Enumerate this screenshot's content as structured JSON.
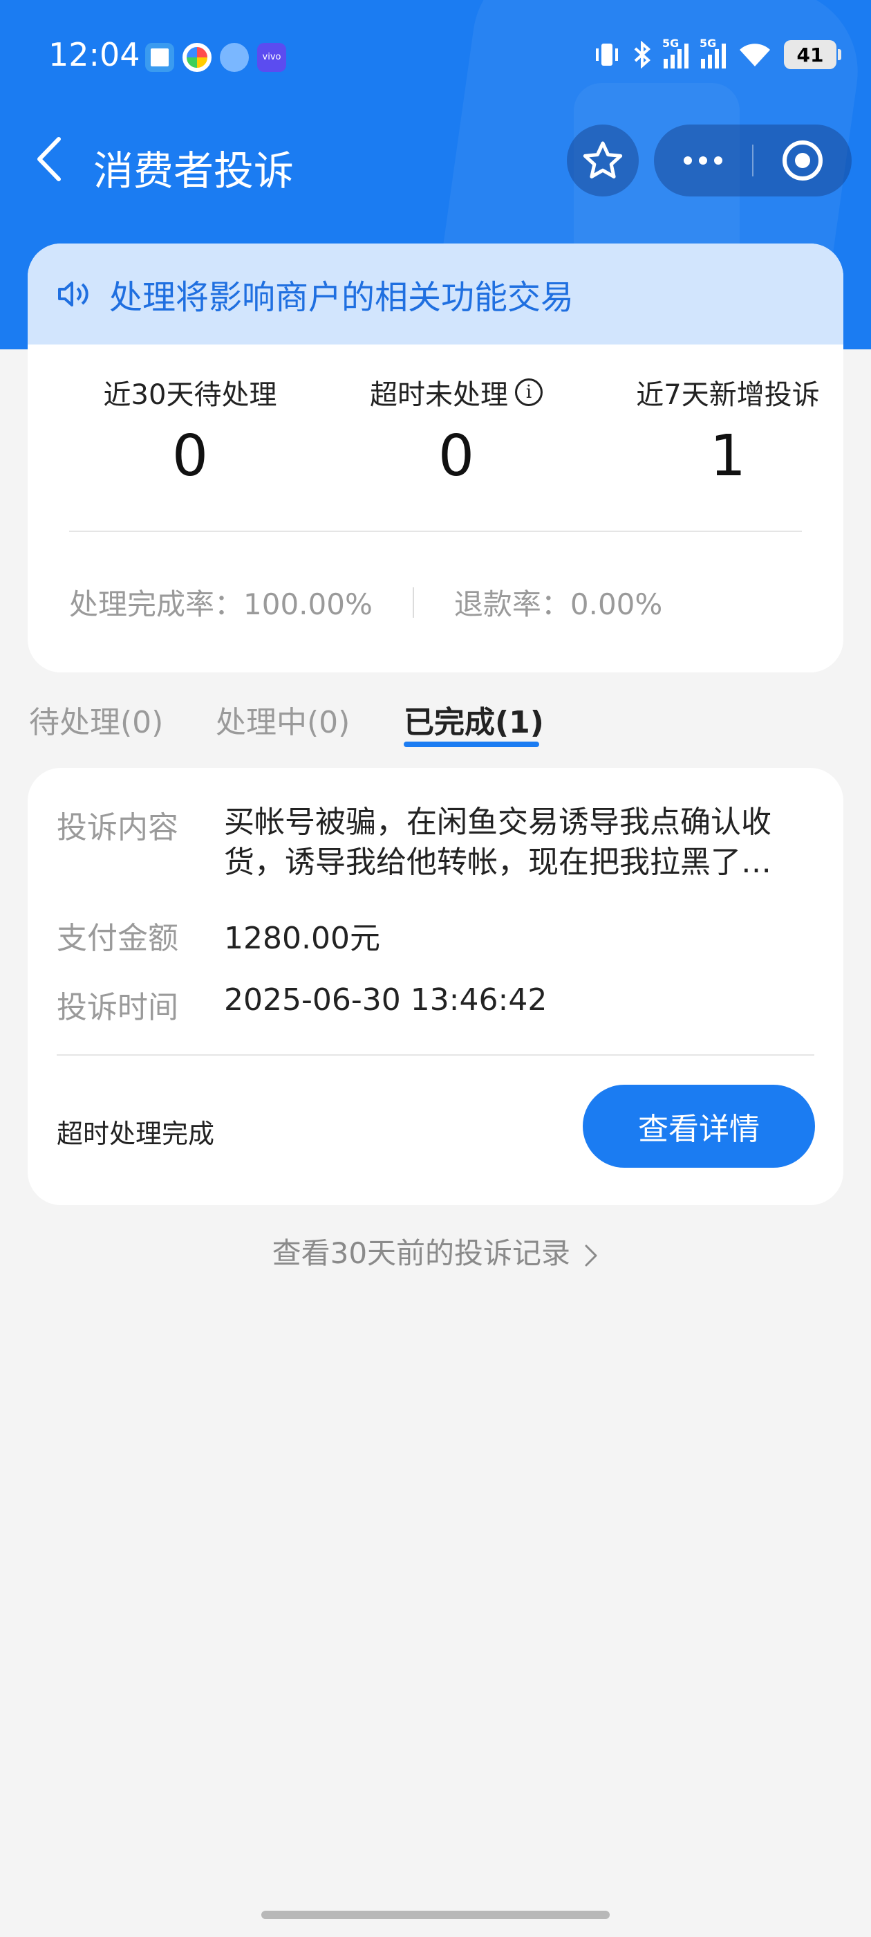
{
  "status_bar": {
    "time": "12:04",
    "notification_icons": [
      "app-icon",
      "app-icon",
      "app-icon",
      "vivo-icon"
    ],
    "vivo_label": "vivo",
    "network_1": "5G",
    "network_2": "5G",
    "battery": "41"
  },
  "navbar": {
    "title": "消费者投诉"
  },
  "notice": {
    "text": "处理将影响商户的相关功能交易"
  },
  "stats": {
    "pending_label": "近30天待处理",
    "pending_value": "0",
    "overdue_label": "超时未处理",
    "overdue_value": "0",
    "new_label": "近7天新增投诉",
    "new_value": "1",
    "completion_rate": "处理完成率：100.00%",
    "refund_rate": "退款率：0.00%"
  },
  "tabs": [
    {
      "label": "待处理(0)"
    },
    {
      "label": "处理中(0)"
    },
    {
      "label": "已完成(1)"
    }
  ],
  "complaint": {
    "content_label": "投诉内容",
    "content_value": "买帐号被骗，在闲鱼交易诱导我点确认收货，诱导我给他转帐，现在把我拉黑了…",
    "amount_label": "支付金额",
    "amount_value": "1280.00元",
    "time_label": "投诉时间",
    "time_value": "2025-06-30 13:46:42",
    "status": "超时处理完成",
    "detail_button": "查看详情"
  },
  "history_link": "查看30天前的投诉记录",
  "colors": {
    "brand_blue": "#1b7cf2",
    "notice_bg": "#d2e5fd",
    "page_bg": "#f4f4f4"
  }
}
